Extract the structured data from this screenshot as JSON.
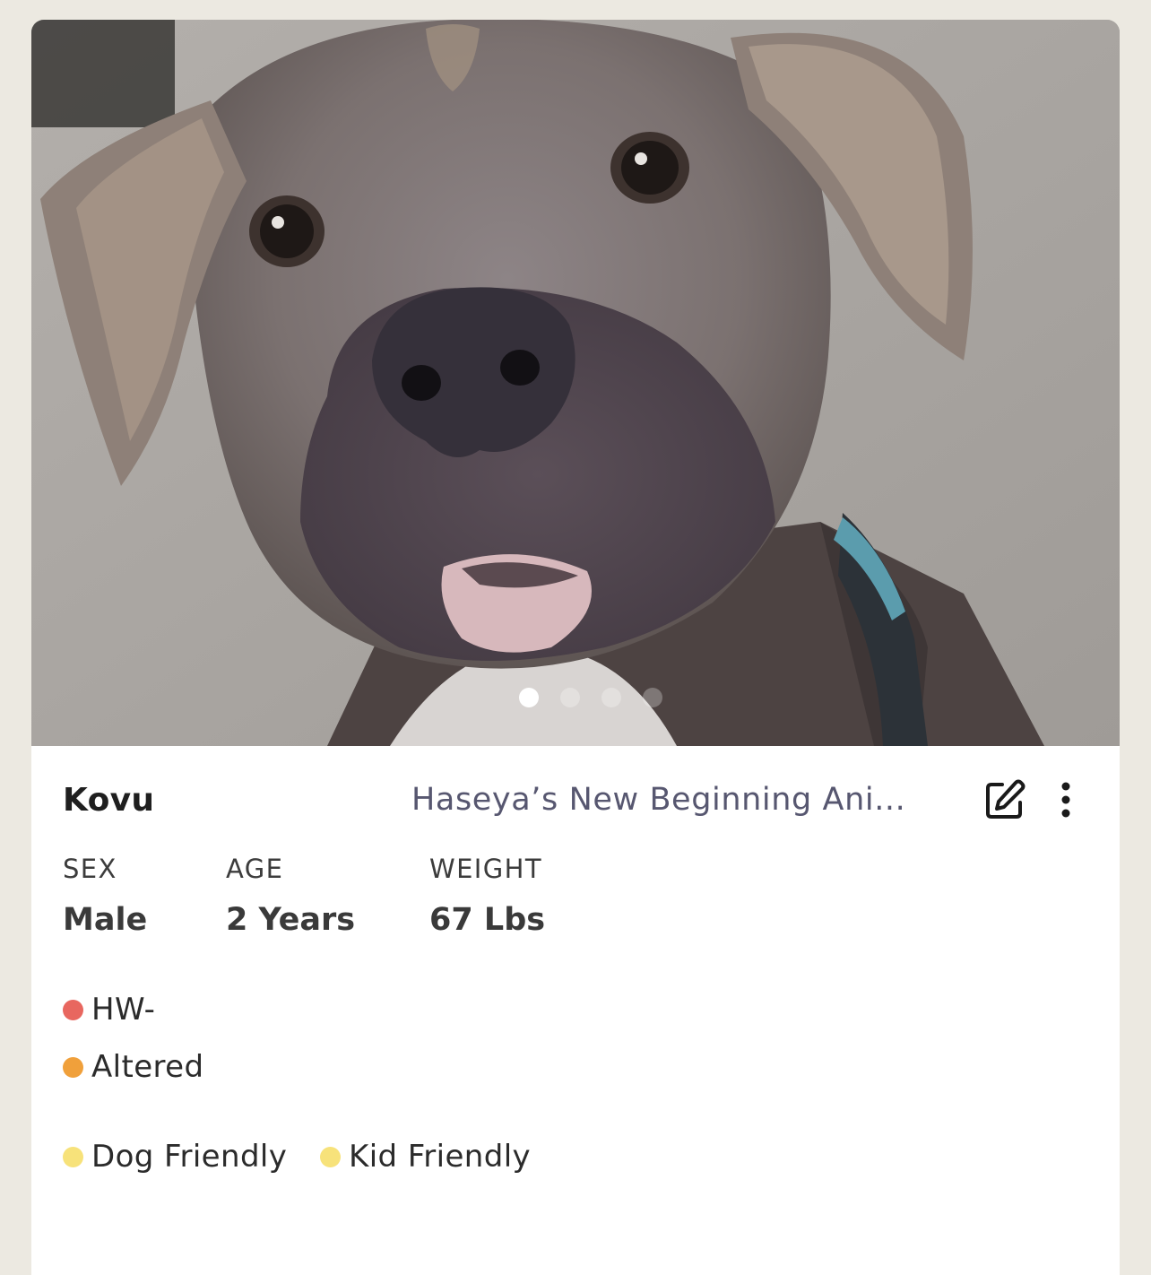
{
  "colors": {
    "page_background": "#ece9e1",
    "card_background": "#ffffff",
    "health_red": "#e8675f",
    "health_orange": "#f0a03b",
    "trait_yellow": "#f7e27a",
    "org_text": "#575770"
  },
  "carousel": {
    "slide_count": 4,
    "active_index": 0
  },
  "pet": {
    "name": "Kovu",
    "organization": "Haseya’s New Beginning Ani...",
    "edit_icon": "edit-icon",
    "more_icon": "more-vertical-icon"
  },
  "stats": {
    "sex": {
      "label": "SEX",
      "value": "Male"
    },
    "age": {
      "label": "AGE",
      "value": "2 Years"
    },
    "weight": {
      "label": "WEIGHT",
      "value": "67 Lbs"
    }
  },
  "health_tags": [
    {
      "label": "HW-",
      "color": "#e8675f"
    },
    {
      "label": "Altered",
      "color": "#f0a03b"
    }
  ],
  "trait_tags": [
    {
      "label": "Dog Friendly",
      "color": "#f7e27a"
    },
    {
      "label": "Kid Friendly",
      "color": "#f7e27a"
    }
  ]
}
